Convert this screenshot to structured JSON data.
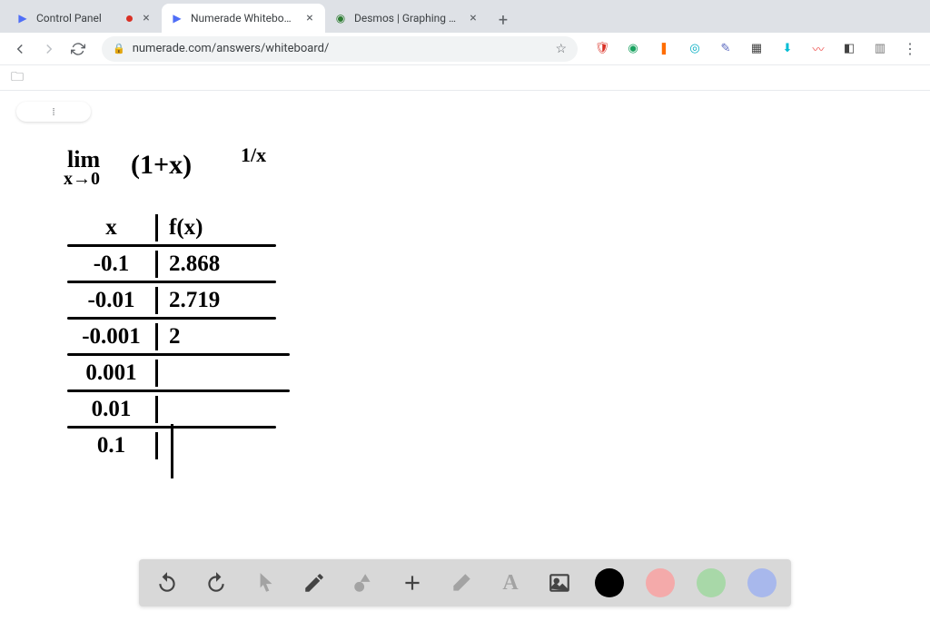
{
  "tabs": [
    {
      "title": "Control Panel",
      "recording": true
    },
    {
      "title": "Numerade Whiteboard",
      "active": true
    },
    {
      "title": "Desmos | Graphing Calculator"
    }
  ],
  "url": "numerade.com/answers/whiteboard/",
  "handwriting": {
    "lim": "lim",
    "sub": "x→0",
    "expr": "(1+x)",
    "exp": "1/x",
    "table": {
      "headers": {
        "x": "x",
        "fx": "f(x)"
      },
      "rows": [
        {
          "x": "-0.1",
          "fx": "2.868"
        },
        {
          "x": "-0.01",
          "fx": "2.719"
        },
        {
          "x": "-0.001",
          "fx": "2"
        },
        {
          "x": "0.001",
          "fx": ""
        },
        {
          "x": "0.01",
          "fx": ""
        },
        {
          "x": "0.1",
          "fx": ""
        }
      ]
    }
  },
  "toolbar": {
    "tools": [
      "undo",
      "redo",
      "pointer",
      "pencil",
      "shapes",
      "plus",
      "eraser",
      "text",
      "image"
    ],
    "colors": [
      "black",
      "red",
      "green",
      "blue"
    ]
  }
}
